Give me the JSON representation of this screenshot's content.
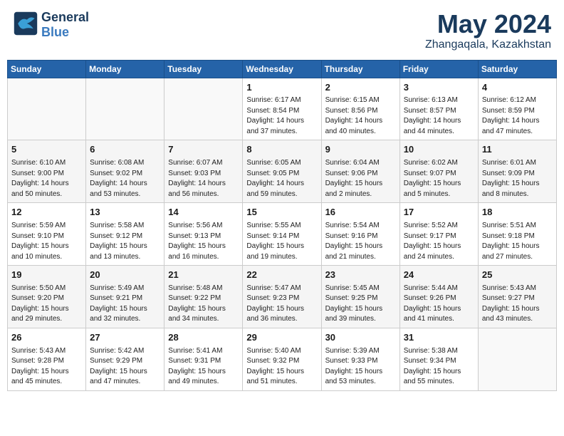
{
  "header": {
    "logo_general": "General",
    "logo_blue": "Blue",
    "month": "May 2024",
    "location": "Zhangaqala, Kazakhstan"
  },
  "weekdays": [
    "Sunday",
    "Monday",
    "Tuesday",
    "Wednesday",
    "Thursday",
    "Friday",
    "Saturday"
  ],
  "weeks": [
    [
      {
        "day": "",
        "sunrise": "",
        "sunset": "",
        "daylight": ""
      },
      {
        "day": "",
        "sunrise": "",
        "sunset": "",
        "daylight": ""
      },
      {
        "day": "",
        "sunrise": "",
        "sunset": "",
        "daylight": ""
      },
      {
        "day": "1",
        "sunrise": "Sunrise: 6:17 AM",
        "sunset": "Sunset: 8:54 PM",
        "daylight": "Daylight: 14 hours and 37 minutes."
      },
      {
        "day": "2",
        "sunrise": "Sunrise: 6:15 AM",
        "sunset": "Sunset: 8:56 PM",
        "daylight": "Daylight: 14 hours and 40 minutes."
      },
      {
        "day": "3",
        "sunrise": "Sunrise: 6:13 AM",
        "sunset": "Sunset: 8:57 PM",
        "daylight": "Daylight: 14 hours and 44 minutes."
      },
      {
        "day": "4",
        "sunrise": "Sunrise: 6:12 AM",
        "sunset": "Sunset: 8:59 PM",
        "daylight": "Daylight: 14 hours and 47 minutes."
      }
    ],
    [
      {
        "day": "5",
        "sunrise": "Sunrise: 6:10 AM",
        "sunset": "Sunset: 9:00 PM",
        "daylight": "Daylight: 14 hours and 50 minutes."
      },
      {
        "day": "6",
        "sunrise": "Sunrise: 6:08 AM",
        "sunset": "Sunset: 9:02 PM",
        "daylight": "Daylight: 14 hours and 53 minutes."
      },
      {
        "day": "7",
        "sunrise": "Sunrise: 6:07 AM",
        "sunset": "Sunset: 9:03 PM",
        "daylight": "Daylight: 14 hours and 56 minutes."
      },
      {
        "day": "8",
        "sunrise": "Sunrise: 6:05 AM",
        "sunset": "Sunset: 9:05 PM",
        "daylight": "Daylight: 14 hours and 59 minutes."
      },
      {
        "day": "9",
        "sunrise": "Sunrise: 6:04 AM",
        "sunset": "Sunset: 9:06 PM",
        "daylight": "Daylight: 15 hours and 2 minutes."
      },
      {
        "day": "10",
        "sunrise": "Sunrise: 6:02 AM",
        "sunset": "Sunset: 9:07 PM",
        "daylight": "Daylight: 15 hours and 5 minutes."
      },
      {
        "day": "11",
        "sunrise": "Sunrise: 6:01 AM",
        "sunset": "Sunset: 9:09 PM",
        "daylight": "Daylight: 15 hours and 8 minutes."
      }
    ],
    [
      {
        "day": "12",
        "sunrise": "Sunrise: 5:59 AM",
        "sunset": "Sunset: 9:10 PM",
        "daylight": "Daylight: 15 hours and 10 minutes."
      },
      {
        "day": "13",
        "sunrise": "Sunrise: 5:58 AM",
        "sunset": "Sunset: 9:12 PM",
        "daylight": "Daylight: 15 hours and 13 minutes."
      },
      {
        "day": "14",
        "sunrise": "Sunrise: 5:56 AM",
        "sunset": "Sunset: 9:13 PM",
        "daylight": "Daylight: 15 hours and 16 minutes."
      },
      {
        "day": "15",
        "sunrise": "Sunrise: 5:55 AM",
        "sunset": "Sunset: 9:14 PM",
        "daylight": "Daylight: 15 hours and 19 minutes."
      },
      {
        "day": "16",
        "sunrise": "Sunrise: 5:54 AM",
        "sunset": "Sunset: 9:16 PM",
        "daylight": "Daylight: 15 hours and 21 minutes."
      },
      {
        "day": "17",
        "sunrise": "Sunrise: 5:52 AM",
        "sunset": "Sunset: 9:17 PM",
        "daylight": "Daylight: 15 hours and 24 minutes."
      },
      {
        "day": "18",
        "sunrise": "Sunrise: 5:51 AM",
        "sunset": "Sunset: 9:18 PM",
        "daylight": "Daylight: 15 hours and 27 minutes."
      }
    ],
    [
      {
        "day": "19",
        "sunrise": "Sunrise: 5:50 AM",
        "sunset": "Sunset: 9:20 PM",
        "daylight": "Daylight: 15 hours and 29 minutes."
      },
      {
        "day": "20",
        "sunrise": "Sunrise: 5:49 AM",
        "sunset": "Sunset: 9:21 PM",
        "daylight": "Daylight: 15 hours and 32 minutes."
      },
      {
        "day": "21",
        "sunrise": "Sunrise: 5:48 AM",
        "sunset": "Sunset: 9:22 PM",
        "daylight": "Daylight: 15 hours and 34 minutes."
      },
      {
        "day": "22",
        "sunrise": "Sunrise: 5:47 AM",
        "sunset": "Sunset: 9:23 PM",
        "daylight": "Daylight: 15 hours and 36 minutes."
      },
      {
        "day": "23",
        "sunrise": "Sunrise: 5:45 AM",
        "sunset": "Sunset: 9:25 PM",
        "daylight": "Daylight: 15 hours and 39 minutes."
      },
      {
        "day": "24",
        "sunrise": "Sunrise: 5:44 AM",
        "sunset": "Sunset: 9:26 PM",
        "daylight": "Daylight: 15 hours and 41 minutes."
      },
      {
        "day": "25",
        "sunrise": "Sunrise: 5:43 AM",
        "sunset": "Sunset: 9:27 PM",
        "daylight": "Daylight: 15 hours and 43 minutes."
      }
    ],
    [
      {
        "day": "26",
        "sunrise": "Sunrise: 5:43 AM",
        "sunset": "Sunset: 9:28 PM",
        "daylight": "Daylight: 15 hours and 45 minutes."
      },
      {
        "day": "27",
        "sunrise": "Sunrise: 5:42 AM",
        "sunset": "Sunset: 9:29 PM",
        "daylight": "Daylight: 15 hours and 47 minutes."
      },
      {
        "day": "28",
        "sunrise": "Sunrise: 5:41 AM",
        "sunset": "Sunset: 9:31 PM",
        "daylight": "Daylight: 15 hours and 49 minutes."
      },
      {
        "day": "29",
        "sunrise": "Sunrise: 5:40 AM",
        "sunset": "Sunset: 9:32 PM",
        "daylight": "Daylight: 15 hours and 51 minutes."
      },
      {
        "day": "30",
        "sunrise": "Sunrise: 5:39 AM",
        "sunset": "Sunset: 9:33 PM",
        "daylight": "Daylight: 15 hours and 53 minutes."
      },
      {
        "day": "31",
        "sunrise": "Sunrise: 5:38 AM",
        "sunset": "Sunset: 9:34 PM",
        "daylight": "Daylight: 15 hours and 55 minutes."
      },
      {
        "day": "",
        "sunrise": "",
        "sunset": "",
        "daylight": ""
      }
    ]
  ]
}
